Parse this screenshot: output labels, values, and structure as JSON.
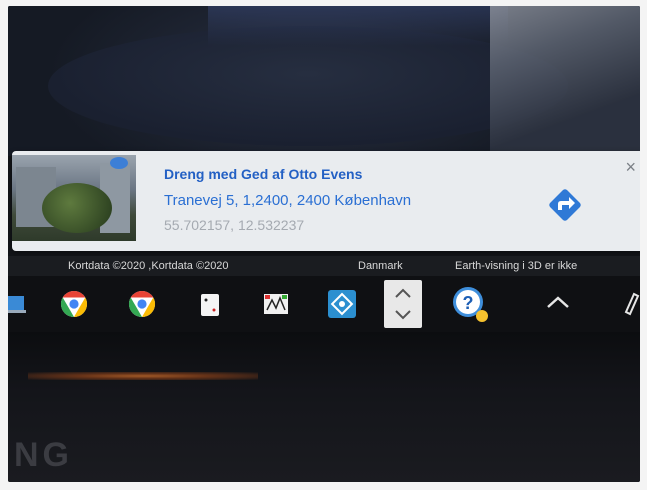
{
  "place_card": {
    "title": "Dreng med Ged af Otto Evens",
    "address": "Tranevej 5, 1,2400, 2400 København",
    "coordinates": "55.702157, 12.532237",
    "close_label": "×",
    "accent_color": "#2360c4"
  },
  "attribution": {
    "map_data": "Kortdata ©2020 ,Kortdata ©2020",
    "country": "Danmark",
    "earth_view": "Earth-visning i 3D er ikke"
  },
  "taskbar": {
    "icons": [
      "windows-app-icon",
      "chrome-icon",
      "chrome-icon",
      "solitaire-icon",
      "paint-icon",
      "virtualbox-icon",
      "scroll-icon",
      "help-icon",
      "chevron-up-icon",
      "pen-icon"
    ]
  },
  "bezel": {
    "brand_fragment": "NG"
  }
}
